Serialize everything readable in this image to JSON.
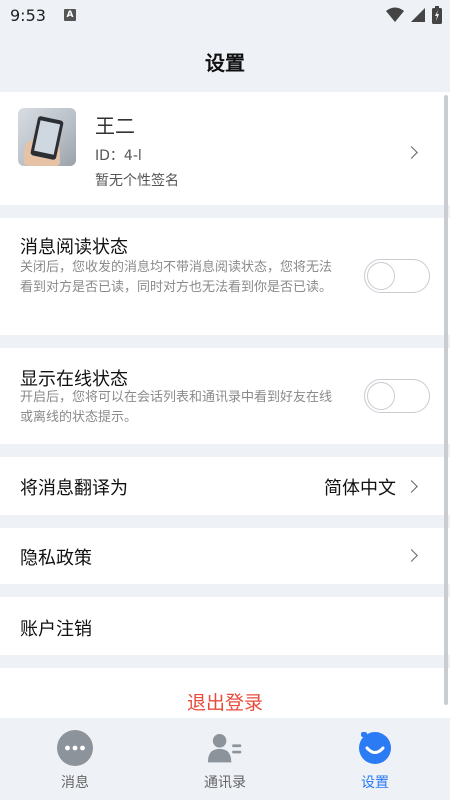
{
  "status_bar": {
    "time": "9:53",
    "a_badge": "A"
  },
  "header": {
    "title": "设置"
  },
  "profile": {
    "name": "王二",
    "id": "ID：4-l",
    "signature": "暂无个性签名"
  },
  "read_status": {
    "title": "消息阅读状态",
    "description": "关闭后，您收发的消息均不带消息阅读状态，您将无法看到对方是否已读，同时对方也无法看到你是否已读。",
    "enabled": false
  },
  "online_status": {
    "title": "显示在线状态",
    "description": "开启后，您将可以在会话列表和通讯录中看到好友在线或离线的状态提示。",
    "enabled": false
  },
  "translate": {
    "title": "将消息翻译为",
    "value": "简体中文"
  },
  "privacy": {
    "title": "隐私政策"
  },
  "account_cancel": {
    "title": "账户注销"
  },
  "logout": {
    "label": "退出登录",
    "color": "#e84b3c"
  },
  "tabs": [
    {
      "label": "消息",
      "icon": "chat-bubble-icon"
    },
    {
      "label": "通讯录",
      "icon": "contacts-icon"
    },
    {
      "label": "设置",
      "icon": "smile-icon",
      "active": true
    }
  ],
  "colors": {
    "accent": "#2b7bf4",
    "background": "#eef1f6"
  }
}
